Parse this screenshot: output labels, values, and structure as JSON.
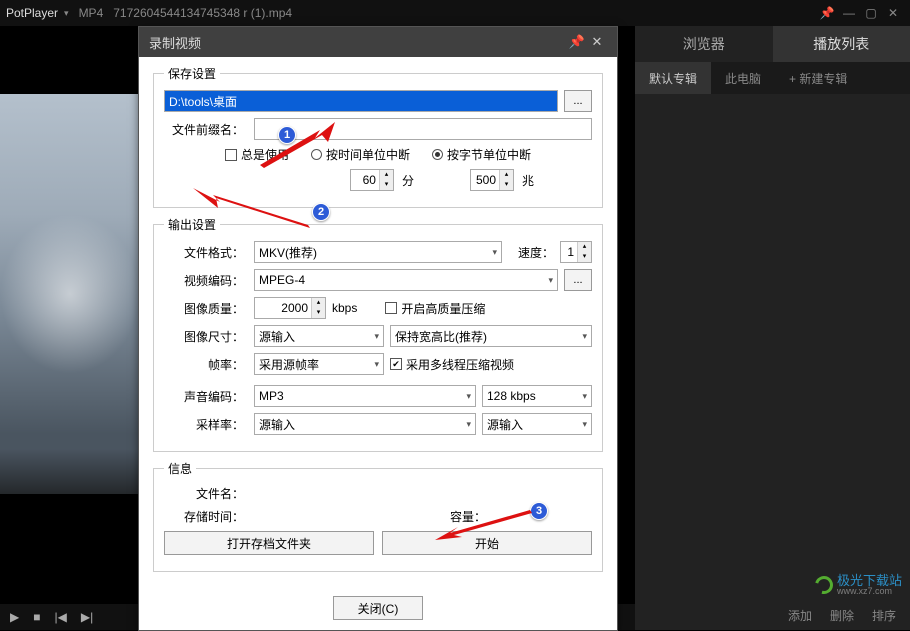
{
  "titlebar": {
    "app": "PotPlayer",
    "format": "MP4",
    "filename": "7172604544134745348 r (1).mp4"
  },
  "sidebar": {
    "tabs": [
      "浏览器",
      "播放列表"
    ],
    "active_tab": 1,
    "subtabs": [
      "默认专辑",
      "此电脑",
      "+ 新建专辑"
    ],
    "active_sub": 0,
    "bottom": [
      "添加",
      "删除",
      "排序"
    ]
  },
  "watermark": {
    "text": "极光下载站",
    "sub": "www.xz7.com"
  },
  "dialog": {
    "title": "录制视频",
    "save": {
      "legend": "保存设置",
      "path": "D:\\tools\\桌面",
      "browse": "...",
      "prefix_label": "文件前缀名：",
      "prefix": "",
      "always_use": "总是使用",
      "break_time": "按时间单位中断",
      "break_byte": "按字节单位中断",
      "minutes_val": "60",
      "minutes_unit": "分",
      "bytes_val": "500",
      "bytes_unit": "兆"
    },
    "output": {
      "legend": "输出设置",
      "format_label": "文件格式：",
      "format": "MKV(推荐)",
      "speed_label": "速度：",
      "speed": "1",
      "vcodec_label": "视频编码：",
      "vcodec": "MPEG-4",
      "vcodec_more": "...",
      "quality_label": "图像质量：",
      "quality": "2000",
      "quality_unit": "kbps",
      "hq_label": "开启高质量压缩",
      "size_label": "图像尺寸：",
      "size": "源输入",
      "aspect_label": "保持宽高比(推荐)",
      "fps_label": "帧率：",
      "fps": "采用源帧率",
      "multi_label": "采用多线程压缩视频",
      "acodec_label": "声音编码：",
      "acodec": "MP3",
      "abitrate": "128 kbps",
      "srate_label": "采样率：",
      "srate": "源输入",
      "srate2": "源输入"
    },
    "info": {
      "legend": "信息",
      "filename_label": "文件名：",
      "time_label": "存储时间：",
      "size_label": "容量：",
      "open_btn": "打开存档文件夹",
      "start_btn": "开始"
    },
    "close": "关闭(C)"
  }
}
